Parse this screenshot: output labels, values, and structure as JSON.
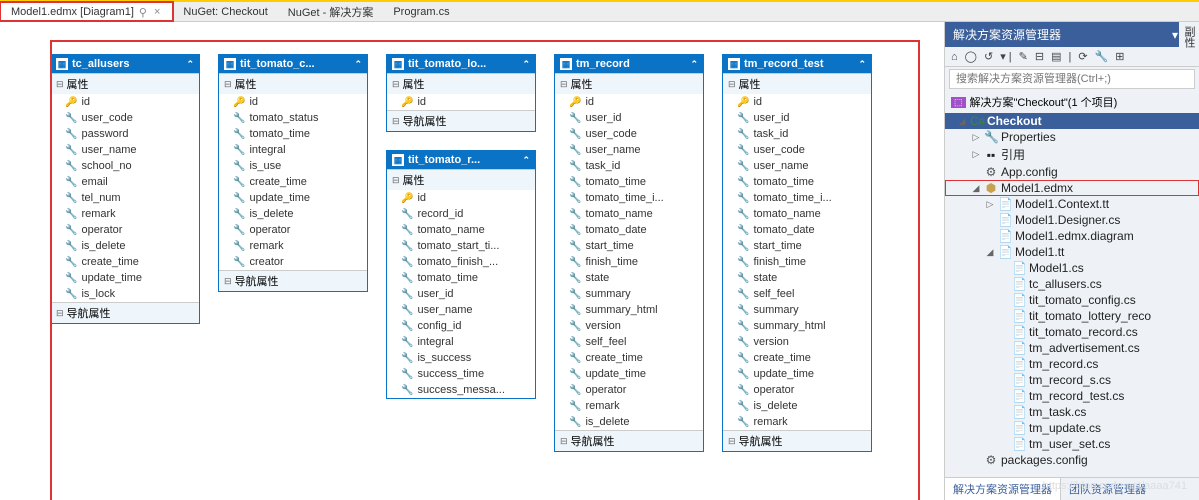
{
  "tabs": [
    {
      "label": "Model1.edmx [Diagram1]",
      "active": true,
      "pinned": true,
      "closable": true
    },
    {
      "label": "NuGet: Checkout"
    },
    {
      "label": "NuGet - 解决方案"
    },
    {
      "label": "Program.cs"
    }
  ],
  "sections": {
    "props": "属性",
    "nav": "导航属性"
  },
  "entities": [
    {
      "name": "tc_allusers",
      "props": [
        "id",
        "user_code",
        "password",
        "user_name",
        "school_no",
        "email",
        "tel_num",
        "remark",
        "operator",
        "is_delete",
        "create_time",
        "update_time",
        "is_lock"
      ],
      "nav": true
    },
    {
      "name": "tit_tomato_c...",
      "props": [
        "id",
        "tomato_status",
        "tomato_time",
        "integral",
        "is_use",
        "create_time",
        "update_time",
        "is_delete",
        "operator",
        "remark",
        "creator"
      ],
      "nav": true
    },
    {
      "name": "tit_tomato_lo...",
      "props": [
        "id"
      ],
      "nav": true
    },
    {
      "name": "tit_tomato_r...",
      "props": [
        "id",
        "record_id",
        "tomato_name",
        "tomato_start_ti...",
        "tomato_finish_...",
        "tomato_time",
        "user_id",
        "user_name",
        "config_id",
        "integral",
        "is_success",
        "success_time",
        "success_messa..."
      ],
      "nav": false
    },
    {
      "name": "tm_record",
      "props": [
        "id",
        "user_id",
        "user_code",
        "user_name",
        "task_id",
        "tomato_time",
        "tomato_time_i...",
        "tomato_name",
        "tomato_date",
        "start_time",
        "finish_time",
        "state",
        "summary",
        "summary_html",
        "version",
        "self_feel",
        "create_time",
        "update_time",
        "operator",
        "remark",
        "is_delete"
      ],
      "nav": true
    },
    {
      "name": "tm_record_test",
      "props": [
        "id",
        "user_id",
        "task_id",
        "user_code",
        "user_name",
        "tomato_time",
        "tomato_time_i...",
        "tomato_name",
        "tomato_date",
        "start_time",
        "finish_time",
        "state",
        "self_feel",
        "summary",
        "summary_html",
        "version",
        "create_time",
        "update_time",
        "operator",
        "is_delete",
        "remark"
      ],
      "nav": true
    }
  ],
  "panel": {
    "title": "解决方案资源管理器",
    "search_placeholder": "搜索解决方案资源管理器(Ctrl+;)",
    "solution": "解决方案\"Checkout\"(1 个项目)",
    "project": "Checkout",
    "nodes": {
      "properties": "Properties",
      "refs": "引用",
      "appconfig": "App.config",
      "model": "Model1.edmx",
      "context": "Model1.Context.tt",
      "designer": "Model1.Designer.cs",
      "diagram": "Model1.edmx.diagram",
      "modeltt": "Model1.tt",
      "cs": [
        "Model1.cs",
        "tc_allusers.cs",
        "tit_tomato_config.cs",
        "tit_tomato_lottery_reco",
        "tit_tomato_record.cs",
        "tm_advertisement.cs",
        "tm_record.cs",
        "tm_record_s.cs",
        "tm_record_test.cs",
        "tm_task.cs",
        "tm_update.cs",
        "tm_user_set.cs"
      ],
      "packages": "packages.config"
    },
    "bottom": [
      "解决方案资源管理器",
      "团队资源管理器"
    ]
  },
  "sidetab": "副性",
  "watermark": "https://blog.csdn.net/aaaa741"
}
